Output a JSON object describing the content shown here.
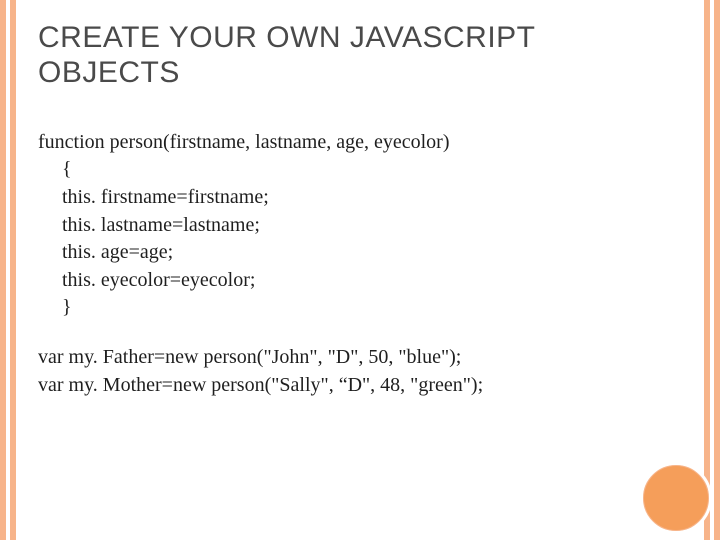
{
  "title": "CREATE YOUR OWN JAVASCRIPT OBJECTS",
  "code": {
    "fn_sig": "function person(firstname, lastname, age, eyecolor)",
    "brace_open": "{",
    "l1": "this. firstname=firstname;",
    "l2": "this. lastname=lastname;",
    "l3": "this. age=age;",
    "l4": "this. eyecolor=eyecolor;",
    "brace_close": "}"
  },
  "usage": {
    "u1": "var my. Father=new person(\"John\", \"D\", 50, \"blue\");",
    "u2": "var my. Mother=new person(\"Sally\", “D\", 48, \"green\");"
  }
}
